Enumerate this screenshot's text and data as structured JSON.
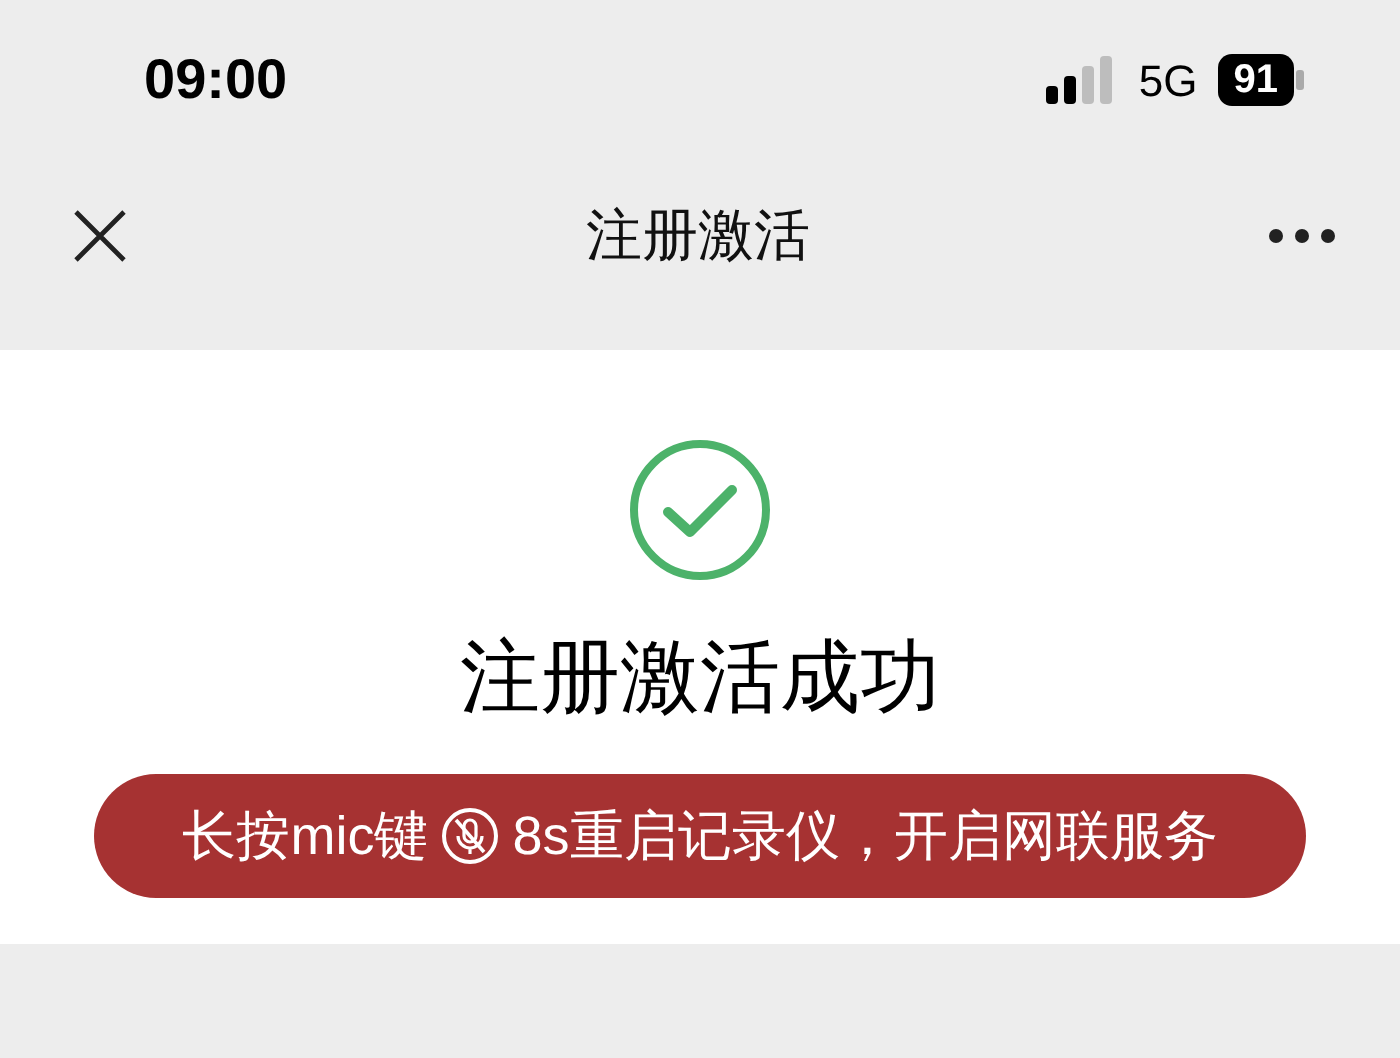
{
  "status_bar": {
    "time": "09:00",
    "network": "5G",
    "battery": "91"
  },
  "nav_bar": {
    "title": "注册激活"
  },
  "result": {
    "message": "注册激活成功"
  },
  "banner": {
    "text_before_icon": "长按mic键",
    "text_after_icon": "8s重启记录仪，开启网联服务"
  }
}
